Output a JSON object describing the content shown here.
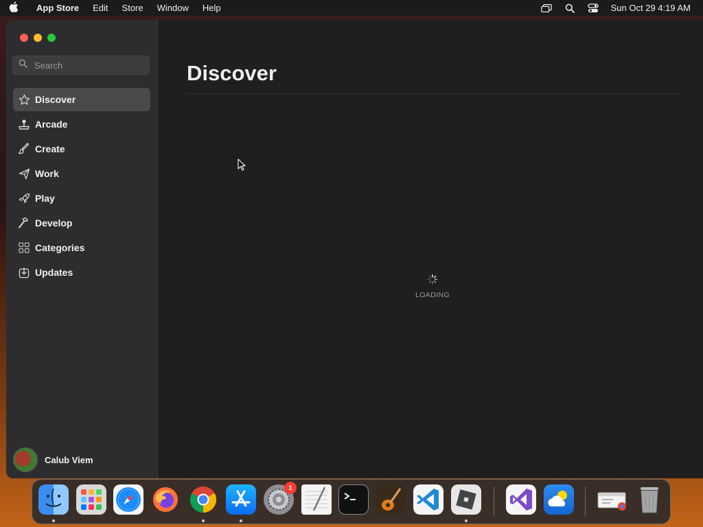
{
  "menubar": {
    "app_name": "App Store",
    "menus": [
      "Edit",
      "Store",
      "Window",
      "Help"
    ],
    "clock": "Sun Oct 29  4:19 AM",
    "status_icons": [
      "screen-mirroring-icon",
      "spotlight-search-icon",
      "control-center-icon"
    ]
  },
  "sidebar": {
    "search": {
      "placeholder": "Search",
      "value": ""
    },
    "items": [
      {
        "label": "Discover",
        "icon": "star-icon",
        "active": true
      },
      {
        "label": "Arcade",
        "icon": "joystick-icon",
        "active": false
      },
      {
        "label": "Create",
        "icon": "paintbrush-icon",
        "active": false
      },
      {
        "label": "Work",
        "icon": "paper-plane-icon",
        "active": false
      },
      {
        "label": "Play",
        "icon": "rocket-icon",
        "active": false
      },
      {
        "label": "Develop",
        "icon": "hammer-icon",
        "active": false
      },
      {
        "label": "Categories",
        "icon": "grid-icon",
        "active": false
      },
      {
        "label": "Updates",
        "icon": "download-tray-icon",
        "active": false
      }
    ],
    "profile_name": "Calub Viem"
  },
  "main": {
    "title": "Discover",
    "loading_text": "LOADING"
  },
  "dock": {
    "apps": [
      {
        "name": "Finder",
        "icon": "finder-icon",
        "running": true
      },
      {
        "name": "Launchpad",
        "icon": "launchpad-icon",
        "running": false
      },
      {
        "name": "Safari",
        "icon": "safari-icon",
        "running": false
      },
      {
        "name": "Firefox",
        "icon": "firefox-icon",
        "running": false
      },
      {
        "name": "Google Chrome",
        "icon": "chrome-icon",
        "running": true
      },
      {
        "name": "App Store",
        "icon": "app-store-icon",
        "running": true
      },
      {
        "name": "System Settings",
        "icon": "system-settings-icon",
        "running": false,
        "badge": "1"
      },
      {
        "name": "TextEdit",
        "icon": "textedit-icon",
        "running": false
      },
      {
        "name": "Terminal",
        "icon": "terminal-icon",
        "running": false
      },
      {
        "name": "GarageBand",
        "icon": "garageband-icon",
        "running": false
      },
      {
        "name": "Visual Studio Code",
        "icon": "vscode-icon",
        "running": false
      },
      {
        "name": "Roblox",
        "icon": "roblox-icon",
        "running": true
      },
      {
        "name": "Visual Studio",
        "icon": "visual-studio-icon",
        "running": false
      },
      {
        "name": "Weather",
        "icon": "weather-icon",
        "running": false
      },
      {
        "name": "Chrome Apps",
        "icon": "chrome-apps-folder-icon",
        "running": false
      },
      {
        "name": "Trash",
        "icon": "trash-icon",
        "running": false
      }
    ]
  },
  "colors": {
    "sidebar_bg": "#2d2d2f",
    "main_bg": "#1f1f1f",
    "active_item": "#4a4a4c",
    "notification_badge": "#ff3b30"
  }
}
